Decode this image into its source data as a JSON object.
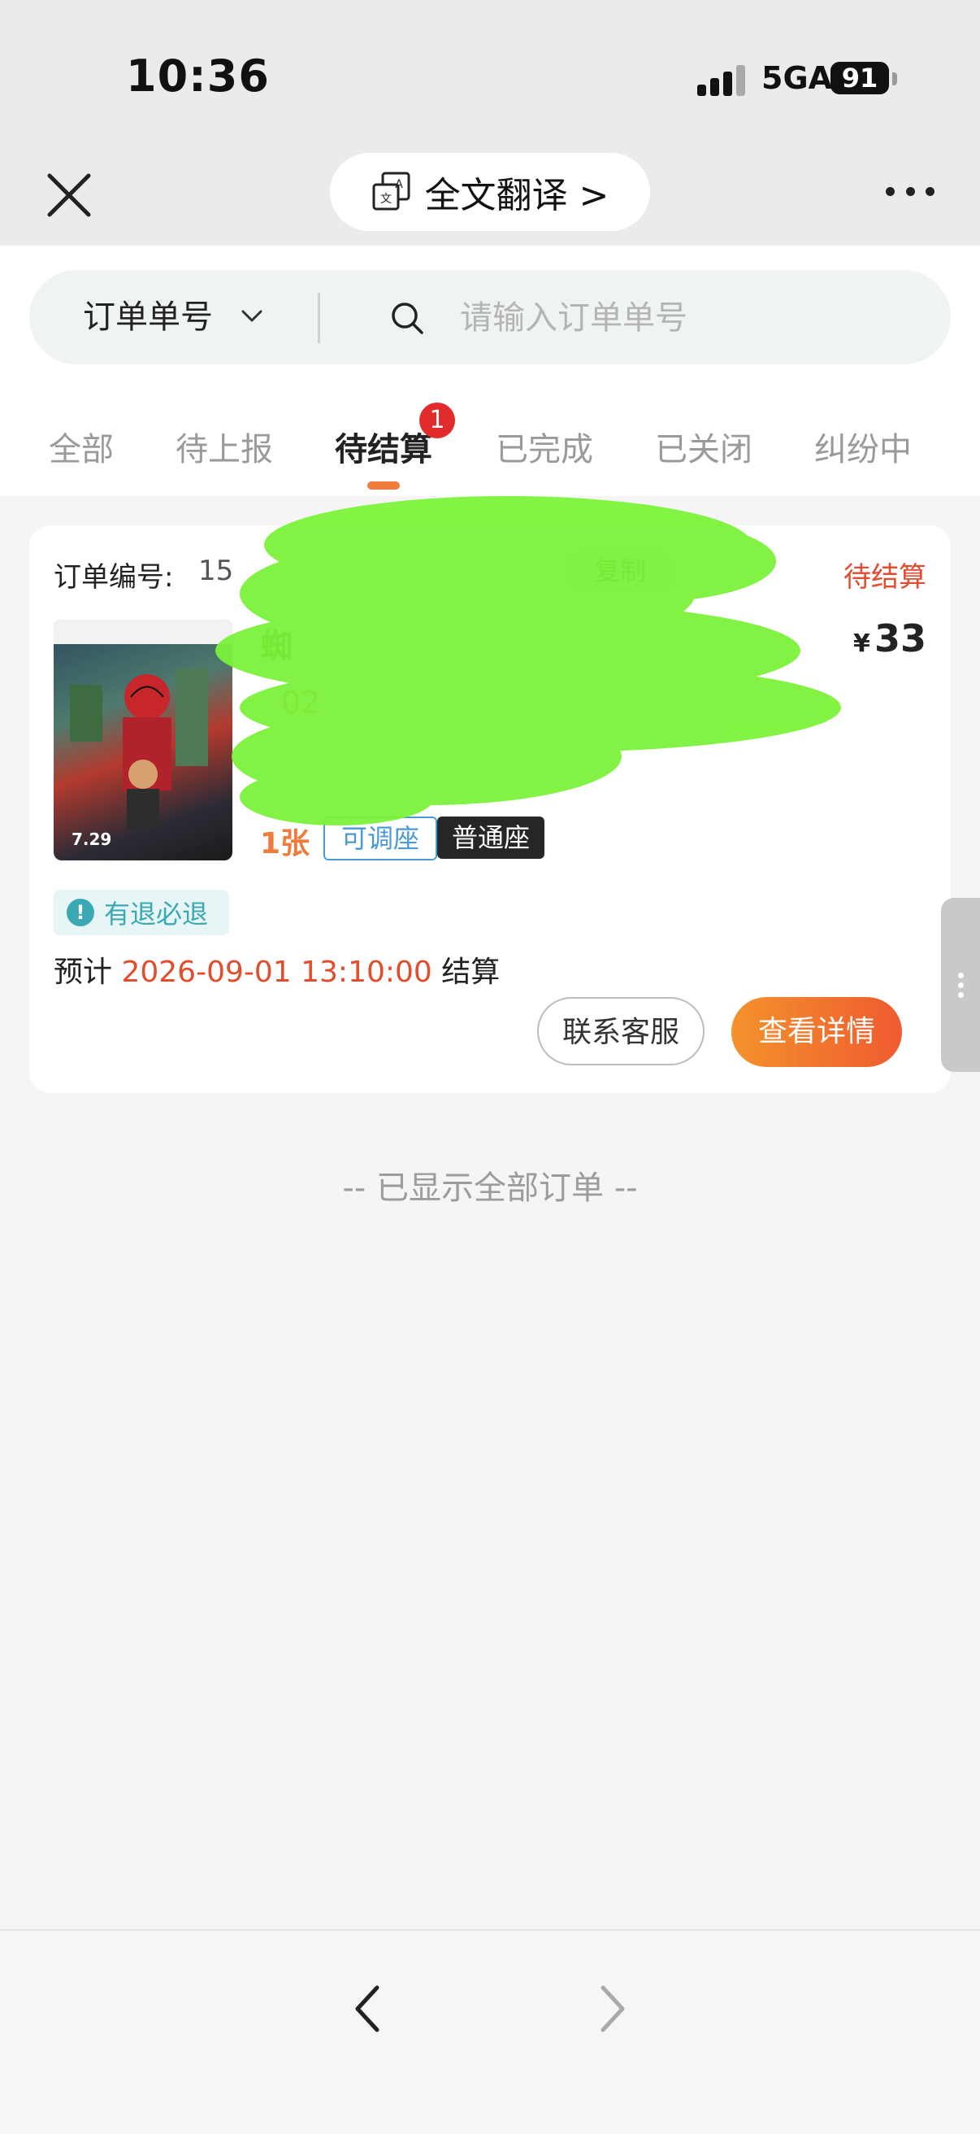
{
  "status_bar": {
    "time": "10:36",
    "network": "5GA",
    "battery": "91"
  },
  "header": {
    "translate_label": "全文翻译 >"
  },
  "search": {
    "type_label": "订单单号",
    "placeholder": "请输入订单单号"
  },
  "tabs": [
    {
      "label": "全部"
    },
    {
      "label": "待上报"
    },
    {
      "label": "待结算",
      "badge": "1"
    },
    {
      "label": "已完成"
    },
    {
      "label": "已关闭"
    },
    {
      "label": "纠纷中"
    }
  ],
  "order": {
    "order_no_label": "订单编号:",
    "order_no_value": "15",
    "copy_label": "复制",
    "status": "待结算",
    "poster_caption": "7.29",
    "movie_name": "蜘",
    "price_currency": "¥",
    "price": "33",
    "show_time": "02",
    "ticket_count": "1张",
    "tag_adjust": "可调座",
    "tag_seat": "普通座",
    "refund_label": "有退必退",
    "settle_prefix": "预计",
    "settle_date": "2026-09-01 13:10:00",
    "settle_suffix": "结算",
    "contact_button": "联系客服",
    "detail_button": "查看详情"
  },
  "end_text": "-- 已显示全部订单 --",
  "colors": {
    "accent": "#e34c2d",
    "orange": "#f07c3b",
    "teal": "#3aa9b4",
    "badge": "#e22b2b"
  }
}
